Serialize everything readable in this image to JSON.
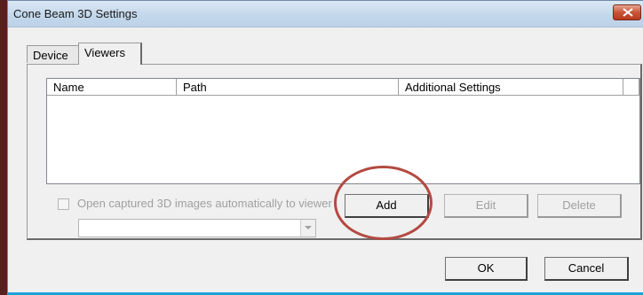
{
  "window": {
    "title": "Cone Beam 3D Settings"
  },
  "tabs": [
    {
      "label": "Device",
      "active": false
    },
    {
      "label": "Viewers",
      "active": true
    }
  ],
  "viewers_list": {
    "columns": [
      "Name",
      "Path",
      "Additional Settings"
    ],
    "rows": []
  },
  "auto_open": {
    "label": "Open captured 3D images automatically to viewer",
    "checked": false,
    "enabled": false
  },
  "viewer_select": {
    "value": "",
    "enabled": false
  },
  "buttons": {
    "add": "Add",
    "edit": "Edit",
    "delete": "Delete",
    "ok": "OK",
    "cancel": "Cancel"
  },
  "icons": {
    "close": "close-icon",
    "dropdown": "chevron-down-icon"
  },
  "colors": {
    "annotation_circle": "#b34a42",
    "close_button": "#c8553a"
  }
}
